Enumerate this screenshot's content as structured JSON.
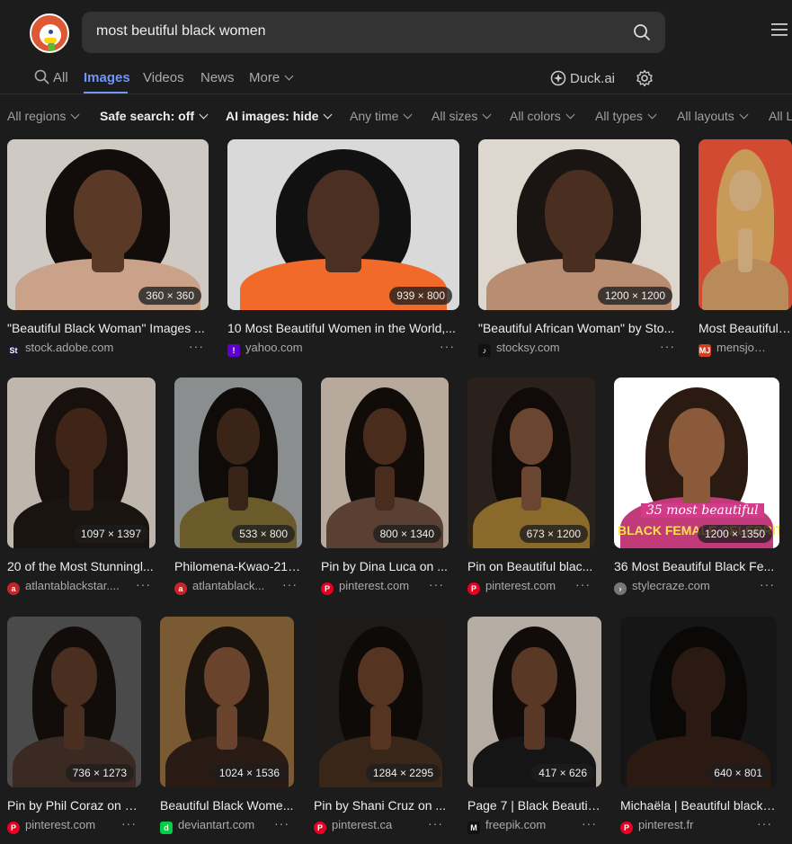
{
  "search": {
    "query": "most beutiful black women"
  },
  "tabs": [
    {
      "label": "All"
    },
    {
      "label": "Images"
    },
    {
      "label": "Videos"
    },
    {
      "label": "News"
    },
    {
      "label": "More"
    }
  ],
  "header_right": {
    "duckai": "Duck.ai"
  },
  "filters": [
    "All regions",
    "Safe search: off",
    "AI images: hide",
    "Any time",
    "All sizes",
    "All colors",
    "All types",
    "All layouts",
    "All L"
  ],
  "colors": {
    "accent": "#7295f6",
    "bg": "#1c1c1c",
    "search_bg": "#333333"
  },
  "results": [
    {
      "title": "\"Beautiful Black Woman\" Images ...",
      "source": "stock.adobe.com",
      "dims": "360 × 360",
      "fav": "St",
      "favbg": "#1a1a2e"
    },
    {
      "title": "10 Most Beautiful Women in the World,...",
      "source": "yahoo.com",
      "dims": "939 × 800",
      "fav": "!",
      "favbg": "#6001d2"
    },
    {
      "title": "\"Beautiful African Woman\" by Sto...",
      "source": "stocksy.com",
      "dims": "1200 × 1200",
      "fav": "♪",
      "favbg": "#111111"
    },
    {
      "title": "Most Beautiful W",
      "source": "mensjournal.c",
      "dims": "",
      "fav": "MJ",
      "favbg": "#d63a1f"
    },
    {
      "title": "20 of the Most Stunningl...",
      "source": "atlantablackstar....",
      "dims": "1097 × 1397",
      "fav": "a",
      "favbg": "#c4242b"
    },
    {
      "title": "Philomena-Kwao-21.j...",
      "source": "atlantablack...",
      "dims": "533 × 800",
      "fav": "a",
      "favbg": "#c4242b"
    },
    {
      "title": "Pin by Dina Luca on ...",
      "source": "pinterest.com",
      "dims": "800 × 1340",
      "fav": "P",
      "favbg": "#e60023"
    },
    {
      "title": "Pin on Beautiful blac...",
      "source": "pinterest.com",
      "dims": "673 × 1200",
      "fav": "P",
      "favbg": "#e60023"
    },
    {
      "title": "36 Most Beautiful Black Fe...",
      "source": "stylecraze.com",
      "dims": "1200 × 1350",
      "fav": "›",
      "favbg": "#777777",
      "overlay1": "35 most beautiful",
      "overlay2": "BLACK FEMALE CELEBRITIES"
    },
    {
      "title": "Pin by Phil Coraz on B...",
      "source": "pinterest.com",
      "dims": "736 × 1273",
      "fav": "P",
      "favbg": "#e60023"
    },
    {
      "title": "Beautiful Black Wome...",
      "source": "deviantart.com",
      "dims": "1024 × 1536",
      "fav": "d",
      "favbg": "#05cc47"
    },
    {
      "title": "Pin by Shani Cruz on ...",
      "source": "pinterest.ca",
      "dims": "1284 × 2295",
      "fav": "P",
      "favbg": "#e60023"
    },
    {
      "title": "Page 7 | Black Beautif...",
      "source": "freepik.com",
      "dims": "417 × 626",
      "fav": "M",
      "favbg": "#111111"
    },
    {
      "title": "Michaëla | Beautiful black ...",
      "source": "pinterest.fr",
      "dims": "640 × 801",
      "fav": "P",
      "favbg": "#e60023"
    }
  ]
}
